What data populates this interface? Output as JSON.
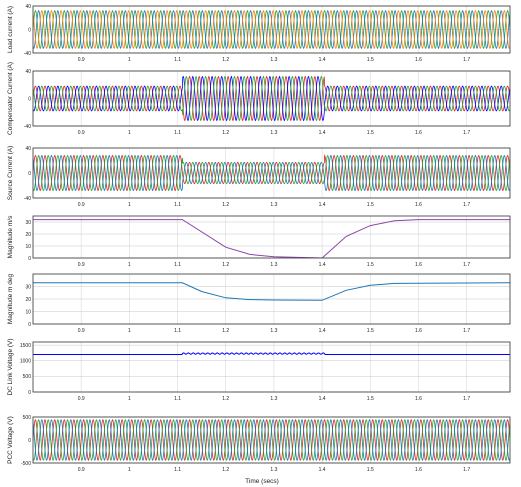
{
  "chart_data": [
    {
      "type": "line",
      "ylabel": "Load current (A)",
      "ylim": [
        -40,
        40
      ],
      "yticks": [
        -40,
        0,
        40
      ],
      "xticks": [
        0.9,
        1,
        1.1,
        1.2,
        1.3,
        1.4,
        1.5,
        1.6,
        1.7
      ],
      "grid": true,
      "series": [
        {
          "phase": "a",
          "color": "#2ca02c",
          "amplitude": 32
        },
        {
          "phase": "b",
          "color": "#1f77b4",
          "amplitude": 32
        },
        {
          "phase": "c",
          "color": "#ff7f0e",
          "amplitude": 32
        }
      ]
    },
    {
      "type": "line",
      "ylabel": "Compensator Current (A)",
      "ylim": [
        -40,
        40
      ],
      "yticks": [
        -40,
        0,
        40
      ],
      "xticks": [
        0.9,
        1,
        1.1,
        1.2,
        1.3,
        1.4,
        1.5,
        1.6,
        1.7
      ],
      "grid": true,
      "series": [
        {
          "phase": "a",
          "color": "#d62728",
          "amplitude_normal": 18,
          "amplitude_sag": 32
        },
        {
          "phase": "b",
          "color": "#0000ff",
          "amplitude_normal": 18,
          "amplitude_sag": 32
        },
        {
          "phase": "c",
          "color": "#2ca02c",
          "amplitude_normal": 18,
          "amplitude_sag": 32
        }
      ]
    },
    {
      "type": "line",
      "ylabel": "Source Current (A)",
      "ylim": [
        -40,
        40
      ],
      "yticks": [
        -40,
        0,
        40
      ],
      "xticks": [
        0.9,
        1,
        1.1,
        1.2,
        1.3,
        1.4,
        1.5,
        1.6,
        1.7
      ],
      "grid": true,
      "series": [
        {
          "phase": "a",
          "color": "#d62728",
          "amplitude_normal": 28,
          "amplitude_sag": 17
        },
        {
          "phase": "b",
          "color": "#2ca02c",
          "amplitude_normal": 28,
          "amplitude_sag": 17
        },
        {
          "phase": "c",
          "color": "#1f77b4",
          "amplitude_normal": 28,
          "amplitude_sag": 17
        }
      ]
    },
    {
      "type": "line",
      "ylabel": "Magnitude m/s",
      "ylim": [
        0,
        35
      ],
      "yticks": [
        0,
        10,
        20,
        30
      ],
      "xticks": [
        0.9,
        1,
        1.1,
        1.2,
        1.3,
        1.4,
        1.5,
        1.6,
        1.7
      ],
      "grid": true,
      "series": [
        {
          "color": "#8e44ad",
          "points": [
            [
              0.8,
              32
            ],
            [
              1.11,
              32
            ],
            [
              1.2,
              9
            ],
            [
              1.25,
              3
            ],
            [
              1.3,
              1
            ],
            [
              1.4,
              0
            ],
            [
              1.45,
              18
            ],
            [
              1.5,
              27
            ],
            [
              1.55,
              31
            ],
            [
              1.6,
              32
            ],
            [
              1.79,
              32
            ]
          ]
        }
      ]
    },
    {
      "type": "line",
      "ylabel": "Magnitude m deg",
      "ylim": [
        0,
        40
      ],
      "yticks": [
        0,
        10,
        20,
        30
      ],
      "xticks": [
        0.9,
        1,
        1.1,
        1.2,
        1.3,
        1.4,
        1.5,
        1.6,
        1.7
      ],
      "grid": true,
      "series": [
        {
          "color": "#1f77b4",
          "points": [
            [
              0.8,
              33
            ],
            [
              1.11,
              33
            ],
            [
              1.15,
              26
            ],
            [
              1.2,
              21
            ],
            [
              1.25,
              19.5
            ],
            [
              1.3,
              19.2
            ],
            [
              1.4,
              19
            ],
            [
              1.45,
              27
            ],
            [
              1.5,
              31
            ],
            [
              1.55,
              32.5
            ],
            [
              1.79,
              33
            ]
          ]
        }
      ]
    },
    {
      "type": "line",
      "ylabel": "DC Link Voltage (V)",
      "ylim": [
        0,
        1600
      ],
      "yticks": [
        0,
        500,
        1000,
        1500
      ],
      "xticks": [
        0.9,
        1,
        1.1,
        1.2,
        1.3,
        1.4,
        1.5,
        1.6,
        1.7
      ],
      "grid": true,
      "series": [
        {
          "color": "#0000ff",
          "baseline": 1200,
          "sag_level": 1230,
          "ripple": 40
        }
      ]
    },
    {
      "type": "line",
      "ylabel": "PCC Voltage (V)",
      "xlabel": "Time (secs)",
      "ylim": [
        -500,
        500
      ],
      "yticks": [
        -500,
        0,
        500
      ],
      "xticks": [
        0.9,
        1,
        1.1,
        1.2,
        1.3,
        1.4,
        1.5,
        1.6,
        1.7
      ],
      "grid": true,
      "series": [
        {
          "phase": "a",
          "color": "#d62728",
          "amplitude": 440
        },
        {
          "phase": "b",
          "color": "#2ca02c",
          "amplitude": 440
        },
        {
          "phase": "c",
          "color": "#1f77b4",
          "amplitude": 440
        }
      ]
    }
  ]
}
